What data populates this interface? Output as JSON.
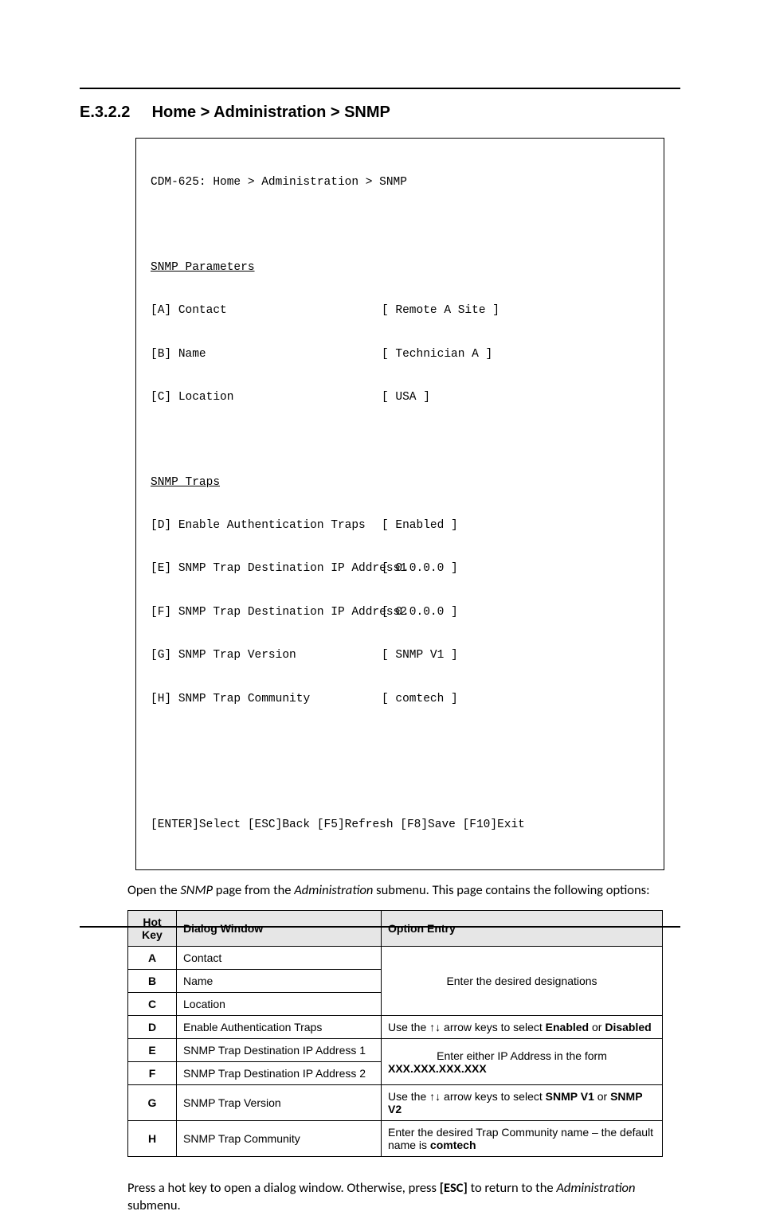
{
  "heading": {
    "number": "E.3.2.2",
    "title": "Home > Administration > SNMP"
  },
  "terminal": {
    "breadcrumb": "CDM-625: Home > Administration > SNMP",
    "section1_title": "SNMP Parameters",
    "params": [
      {
        "key": "[A]",
        "label": "Contact",
        "value": "[ Remote A Site ]"
      },
      {
        "key": "[B]",
        "label": "Name",
        "value": "[ Technician A ]"
      },
      {
        "key": "[C]",
        "label": "Location",
        "value": "[ USA ]"
      }
    ],
    "section2_title": "SNMP Traps",
    "traps": [
      {
        "key": "[D]",
        "label": "Enable Authentication Traps",
        "value": "[ Enabled ]"
      },
      {
        "key": "[E]",
        "label": "SNMP Trap Destination IP Address1",
        "value": "[ 0.0.0.0 ]"
      },
      {
        "key": "[F]",
        "label": "SNMP Trap Destination IP Address2",
        "value": "[ 0.0.0.0 ]"
      },
      {
        "key": "[G]",
        "label": "SNMP Trap Version",
        "value": "[ SNMP V1 ]"
      },
      {
        "key": "[H]",
        "label": "SNMP Trap Community",
        "value": "[ comtech ]"
      }
    ],
    "footer": "[ENTER]Select [ESC]Back [F5]Refresh [F8]Save [F10]Exit"
  },
  "intro": {
    "pre": "Open the ",
    "em1": "SNMP",
    "mid": " page from the ",
    "em2": "Administration",
    "post": " submenu. This page contains the following options:"
  },
  "table": {
    "headers": {
      "hk1": "Hot",
      "hk2": "Key",
      "dw": "Dialog Window",
      "oe": "Option Entry"
    },
    "rows": {
      "A": {
        "dw": "Contact"
      },
      "B": {
        "dw": "Name"
      },
      "C": {
        "dw": "Location"
      },
      "D": {
        "dw": "Enable Authentication Traps"
      },
      "E": {
        "dw": "SNMP Trap Destination IP Address 1"
      },
      "F": {
        "dw": "SNMP Trap Destination IP Address 2"
      },
      "G": {
        "dw": "SNMP Trap Version"
      },
      "H": {
        "dw": "SNMP Trap Community"
      }
    },
    "entries": {
      "abc": "Enter the desired designations",
      "d_pre": "Use the ",
      "d_arrows": "↑↓",
      "d_mid": " arrow keys to select ",
      "d_b1": "Enabled",
      "d_or": " or ",
      "d_b2": "Disabled",
      "ef_text": "Enter either IP Address in the form ",
      "ef_bold": "XXX.XXX.XXX.XXX",
      "g_pre": "Use the ",
      "g_arrows": "↑↓",
      "g_mid": " arrow keys to select ",
      "g_b1": "SNMP V1",
      "g_or": " or ",
      "g_b2": "SNMP V2",
      "h_text": "Enter the desired Trap Community name – the default name is ",
      "h_bold": "comtech"
    },
    "keys": {
      "A": "A",
      "B": "B",
      "C": "C",
      "D": "D",
      "E": "E",
      "F": "F",
      "G": "G",
      "H": "H"
    }
  },
  "footer_para": {
    "pre": "Press a hot key to open a dialog window. Otherwise, press ",
    "esc": "[ESC]",
    "mid": " to return to the ",
    "em": "Administration",
    "post": " submenu."
  }
}
